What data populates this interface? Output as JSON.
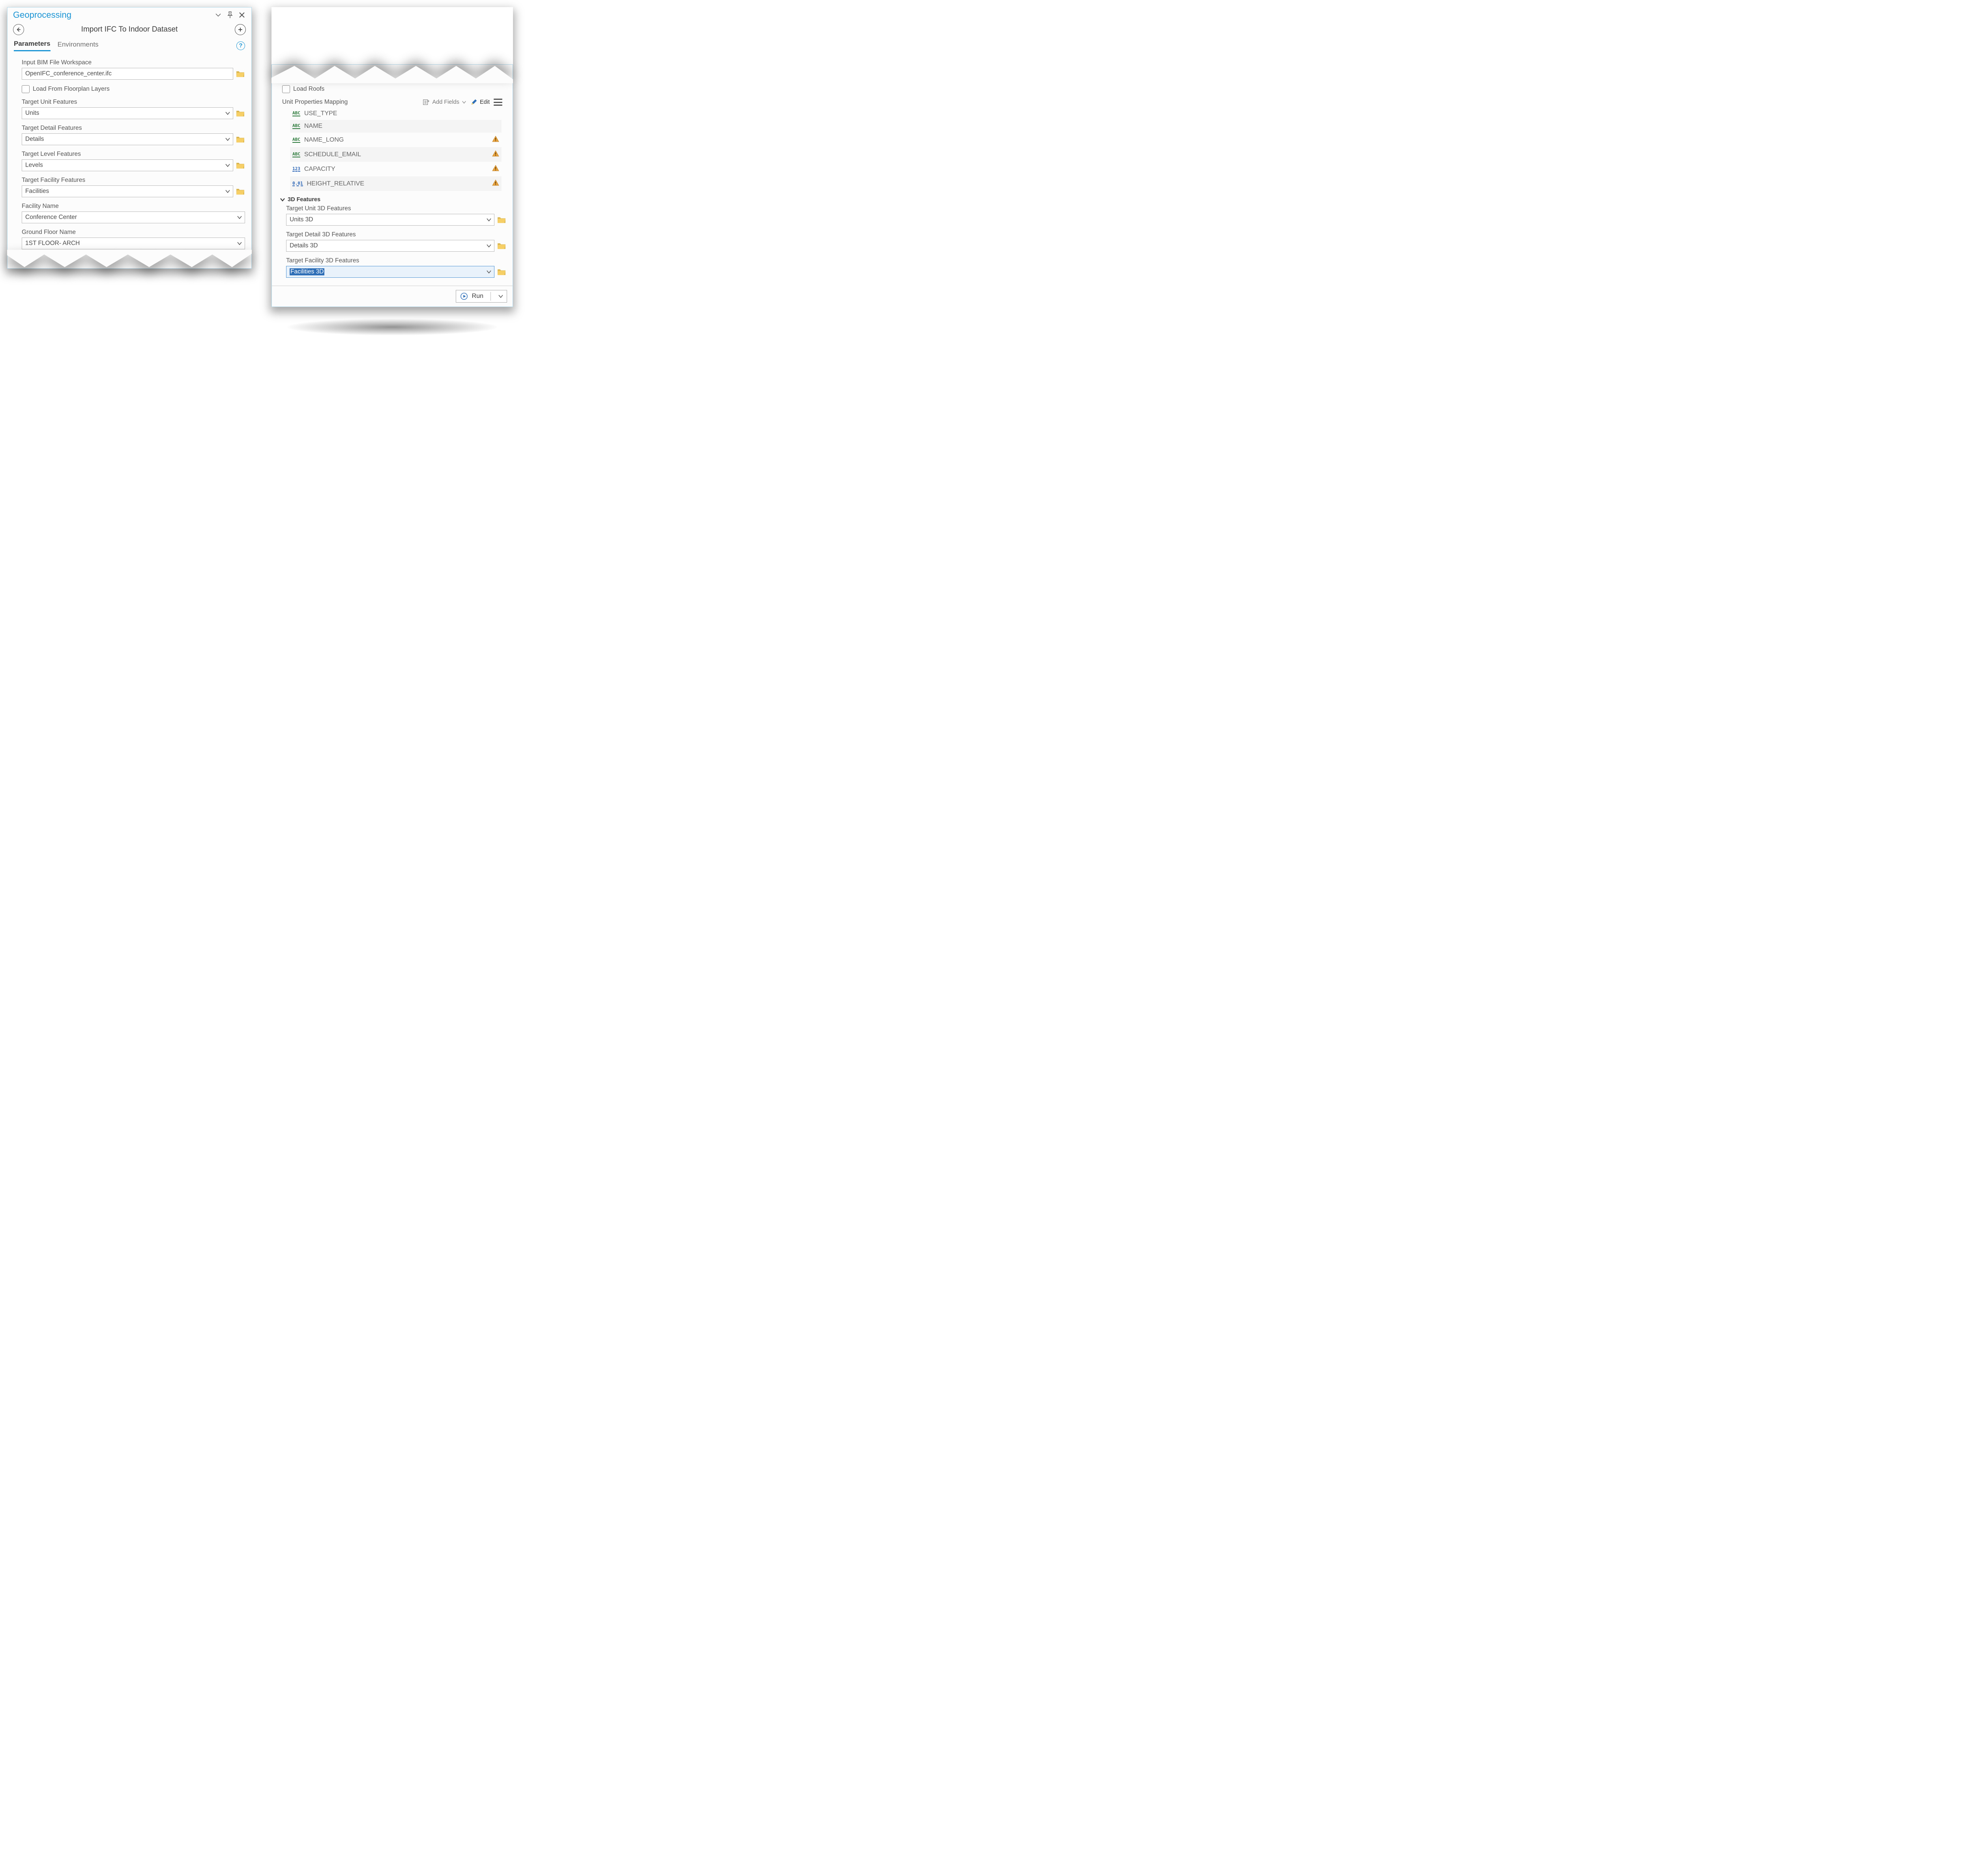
{
  "window": {
    "title": "Geoprocessing"
  },
  "toolheader": {
    "title": "Import IFC To Indoor Dataset"
  },
  "tabs": {
    "parameters": "Parameters",
    "environments": "Environments"
  },
  "left": {
    "input_bim_label": "Input BIM File Workspace",
    "input_bim_value": "OpenIFC_conference_center.ifc",
    "load_floorplan_label": "Load From Floorplan Layers",
    "target_unit_label": "Target Unit Features",
    "target_unit_value": "Units",
    "target_detail_label": "Target Detail Features",
    "target_detail_value": "Details",
    "target_level_label": "Target Level Features",
    "target_level_value": "Levels",
    "target_facility_label": "Target Facility Features",
    "target_facility_value": "Facilities",
    "facility_name_label": "Facility Name",
    "facility_name_value": "Conference Center",
    "ground_floor_label": "Ground Floor Name",
    "ground_floor_value": "1ST FLOOR- ARCH"
  },
  "right": {
    "load_roofs_label": "Load Roofs",
    "mapping_header": "Unit Properties Mapping",
    "add_fields_label": "Add Fields",
    "edit_label": "Edit",
    "items": [
      {
        "type": "ABC",
        "name": "USE_TYPE",
        "warn": false
      },
      {
        "type": "ABC",
        "name": "NAME",
        "warn": false
      },
      {
        "type": "ABC",
        "name": "NAME_LONG",
        "warn": true
      },
      {
        "type": "ABC",
        "name": "SCHEDULE_EMAIL",
        "warn": true
      },
      {
        "type": "123",
        "name": "CAPACITY",
        "warn": true
      },
      {
        "type": "0.01",
        "name": "HEIGHT_RELATIVE",
        "warn": true
      }
    ],
    "section_3d_label": "3D Features",
    "target_unit3d_label": "Target Unit 3D Features",
    "target_unit3d_value": "Units 3D",
    "target_detail3d_label": "Target Detail 3D Features",
    "target_detail3d_value": "Details 3D",
    "target_facility3d_label": "Target Facility 3D Features",
    "target_facility3d_value": "Facilities 3D",
    "run_label": "Run"
  }
}
